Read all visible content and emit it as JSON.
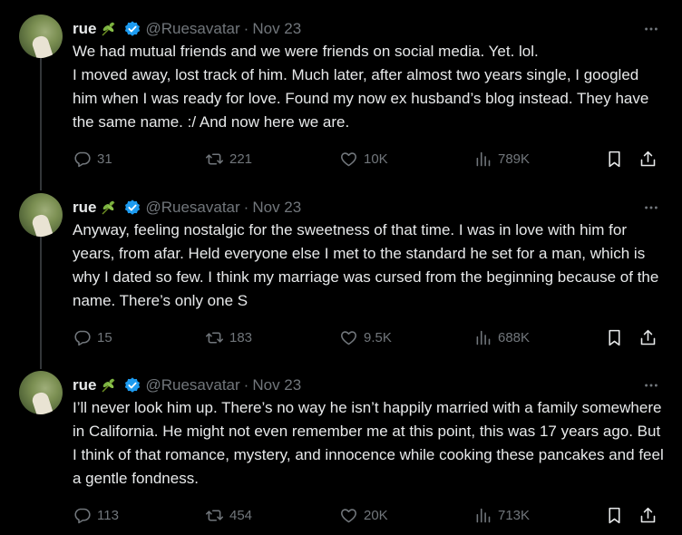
{
  "tweets": [
    {
      "name": "rue",
      "handle": "@Ruesavatar",
      "separator": "·",
      "date": "Nov 23",
      "text": "We had mutual friends and we were friends on social media. Yet. lol.\nI moved away, lost track of him. Much later, after almost two years single, I googled him when I was ready for love. Found my now ex husband’s blog instead. They have the same name. :/ And now here we are.",
      "replies": "31",
      "retweets": "221",
      "likes": "10K",
      "views": "789K"
    },
    {
      "name": "rue",
      "handle": "@Ruesavatar",
      "separator": "·",
      "date": "Nov 23",
      "text": "Anyway, feeling nostalgic for the sweetness of that time. I was in love with him for years, from afar. Held everyone else I met to the standard he set for a man, which is why I dated so few. I think my marriage was cursed from the beginning because of the name. There’s only one S",
      "replies": "15",
      "retweets": "183",
      "likes": "9.5K",
      "views": "688K"
    },
    {
      "name": "rue",
      "handle": "@Ruesavatar",
      "separator": "·",
      "date": "Nov 23",
      "text": "I’ll never look him up. There’s no way he isn’t happily married with a family somewhere in California. He might not even remember me at this point, this was 17 years ago. But I think of that romance, mystery, and innocence while cooking these pancakes and feel a gentle fondness.",
      "replies": "113",
      "retweets": "454",
      "likes": "20K",
      "views": "713K"
    }
  ],
  "icons": {
    "leaf": "leaf-emoji-icon",
    "verified": "verified-badge-icon",
    "more": "more-dots-icon",
    "reply": "reply-icon",
    "retweet": "retweet-icon",
    "like": "heart-icon",
    "views": "views-chart-icon",
    "bookmark": "bookmark-icon",
    "share": "share-icon"
  },
  "colors": {
    "background": "#000000",
    "text": "#e7e9ea",
    "secondary": "#71767b",
    "verified": "#1d9bf0"
  }
}
